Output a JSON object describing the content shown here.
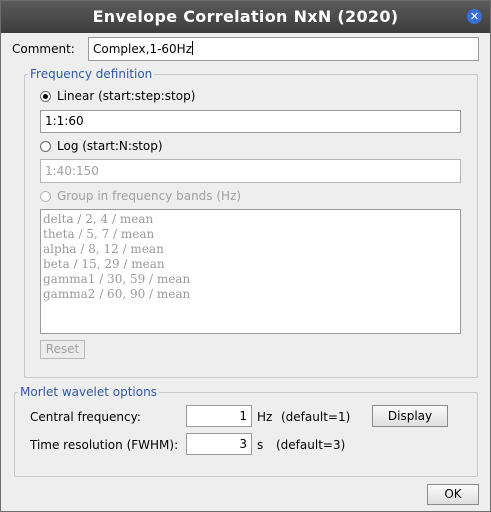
{
  "window": {
    "title": "Envelope Correlation NxN (2020)",
    "close_glyph": "✕"
  },
  "comment": {
    "label": "Comment:",
    "value": "Complex,1-60Hz"
  },
  "frequency": {
    "title": "Frequency definition",
    "linear": {
      "label": "Linear (start:step:stop)",
      "value": "1:1:60",
      "selected": true
    },
    "log": {
      "label": "Log (start:N:stop)",
      "value": "1:40:150",
      "selected": false
    },
    "bands": {
      "label": "Group in frequency bands (Hz)",
      "selected": false,
      "items": [
        "delta / 2, 4 / mean",
        "theta / 5, 7 / mean",
        "alpha / 8, 12 / mean",
        "beta / 15, 29 / mean",
        "gamma1 / 30, 59 / mean",
        "gamma2 / 60, 90 / mean"
      ]
    },
    "reset_label": "Reset"
  },
  "morlet": {
    "title": "Morlet wavelet options",
    "central": {
      "label": "Central frequency:",
      "value": "1",
      "unit": "Hz",
      "default": "(default=1)"
    },
    "display_label": "Display",
    "time": {
      "label": "Time resolution (FWHM):",
      "value": "3",
      "unit": "s",
      "default": "(default=3)"
    }
  },
  "ok_label": "OK"
}
